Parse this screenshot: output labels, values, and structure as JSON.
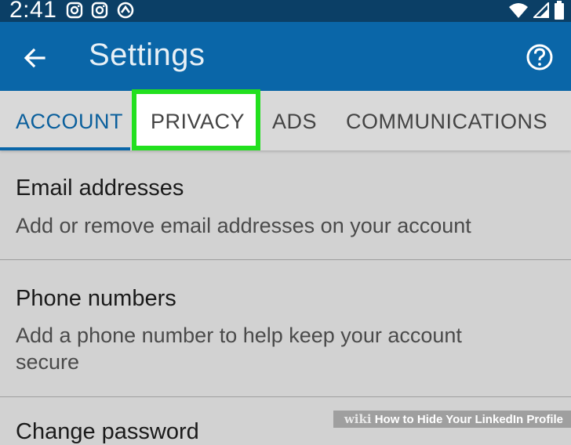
{
  "status_bar": {
    "time": "2:41",
    "left_icons": [
      "instagram-icon",
      "instagram-icon",
      "sync-icon"
    ],
    "right_icons": [
      "wifi-icon",
      "signal-icon",
      "battery-icon"
    ]
  },
  "app_bar": {
    "title": "Settings",
    "color": "#0a66a8"
  },
  "tabs": [
    {
      "label": "ACCOUNT",
      "active": true
    },
    {
      "label": "PRIVACY",
      "highlighted": true
    },
    {
      "label": "ADS"
    },
    {
      "label": "COMMUNICATIONS"
    }
  ],
  "settings": [
    {
      "title": "Email addresses",
      "description": "Add or remove email addresses on your account"
    },
    {
      "title": "Phone numbers",
      "description": "Add a phone number to help keep your account secure"
    },
    {
      "title": "Change password"
    }
  ],
  "watermark": {
    "brand": "wiki",
    "text": "How to Hide Your LinkedIn Profile"
  },
  "colors": {
    "status_bar": "#0b3f66",
    "accent": "#0a66a8",
    "highlight": "#22e01e"
  }
}
